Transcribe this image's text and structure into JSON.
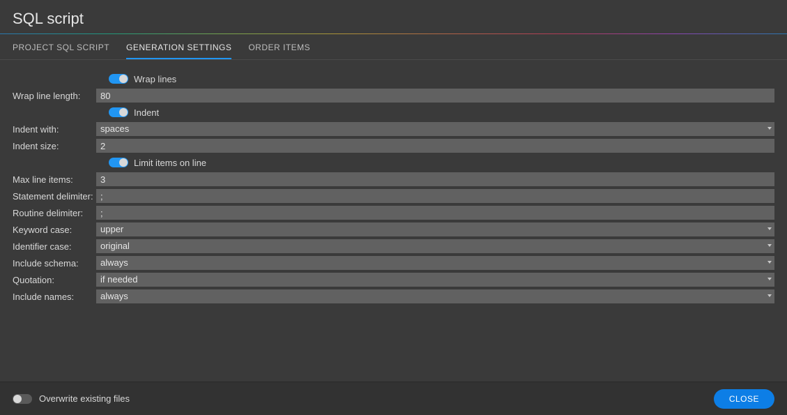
{
  "title": "SQL script",
  "tabs": {
    "project": "PROJECT SQL SCRIPT",
    "generation": "GENERATION SETTINGS",
    "order": "ORDER ITEMS"
  },
  "toggles": {
    "wrap_lines": "Wrap lines",
    "indent": "Indent",
    "limit_items": "Limit items on line"
  },
  "labels": {
    "wrap_length": "Wrap line length:",
    "indent_with": "Indent with:",
    "indent_size": "Indent size:",
    "max_line_items": "Max line items:",
    "statement_delim": "Statement delimiter:",
    "routine_delim": "Routine delimiter:",
    "keyword_case": "Keyword case:",
    "identifier_case": "Identifier case:",
    "include_schema": "Include schema:",
    "quotation": "Quotation:",
    "include_names": "Include names:"
  },
  "values": {
    "wrap_length": "80",
    "indent_with": "spaces",
    "indent_size": "2",
    "max_line_items": "3",
    "statement_delim": ";",
    "routine_delim": ";",
    "keyword_case": "upper",
    "identifier_case": "original",
    "include_schema": "always",
    "quotation": "if needed",
    "include_names": "always"
  },
  "footer": {
    "overwrite": "Overwrite existing files",
    "close": "CLOSE"
  }
}
